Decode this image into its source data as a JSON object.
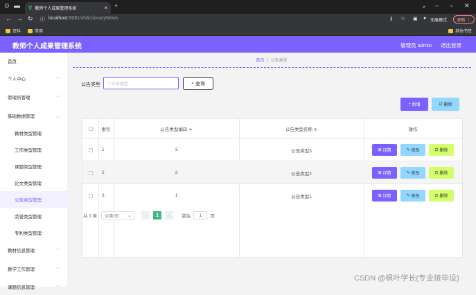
{
  "browser": {
    "tab_title": "教师个人成果管理系统",
    "tab_close": "×",
    "new_tab": "+",
    "url_host": "localhost",
    "url_rest": ":8081/#/dictionaryNews",
    "incognito_label": "无痕模式",
    "update_label": "更新",
    "bookmarks": [
      "资料",
      "常用"
    ],
    "other_bookmarks": "其他书签"
  },
  "header": {
    "title": "教师个人成果管理系统",
    "user": "管理员 admin",
    "logout": "退出登录",
    "accent_color": "#7b61ff"
  },
  "sidebar": {
    "items": [
      {
        "label": "首页",
        "sub": false
      },
      {
        "label": "个人中心",
        "sub": false,
        "chevron": "﹀"
      },
      {
        "label": "管理员管理",
        "sub": false,
        "chevron": "﹀"
      },
      {
        "label": "基础数据管理",
        "sub": false,
        "chevron": "︿"
      },
      {
        "label": "教材类型管理",
        "sub": true
      },
      {
        "label": "工作类型管理",
        "sub": true
      },
      {
        "label": "课题类型管理",
        "sub": true
      },
      {
        "label": "论文类型管理",
        "sub": true
      },
      {
        "label": "公告类型管理",
        "sub": true,
        "active": true
      },
      {
        "label": "荣誉类型管理",
        "sub": true
      },
      {
        "label": "专利类型管理",
        "sub": true
      },
      {
        "label": "教材信息管理",
        "sub": false,
        "chevron": "﹀"
      },
      {
        "label": "教学工作管理",
        "sub": false,
        "chevron": "﹀"
      },
      {
        "label": "课题信息管理",
        "sub": false,
        "chevron": "﹀"
      }
    ]
  },
  "breadcrumb": {
    "home": "首页",
    "current": "公告类型"
  },
  "filter": {
    "label": "公告类型",
    "placeholder": "公告类型",
    "search_button": "查询"
  },
  "actions": {
    "add": "新增",
    "delete": "删除"
  },
  "table": {
    "headers": {
      "index": "索引",
      "code": "公告类型编码 ≑",
      "name": "公告类型名称 ≑",
      "ops": "操作"
    },
    "rows": [
      {
        "index": "1",
        "code": "3",
        "name": "公告类型3"
      },
      {
        "index": "2",
        "code": "2",
        "name": "公告类型2"
      },
      {
        "index": "3",
        "code": "1",
        "name": "公告类型1"
      }
    ],
    "op_labels": {
      "detail": "详情",
      "edit": "修改",
      "remove": "删除"
    }
  },
  "pagination": {
    "total": "共 3 条",
    "page_size": "10条/页",
    "prev": "‹",
    "current_page": "1",
    "next": "›",
    "goto_prefix": "前往",
    "goto_value": "1",
    "goto_suffix": "页"
  },
  "watermark": "CSDN @枫叶学长(专业接毕设)"
}
